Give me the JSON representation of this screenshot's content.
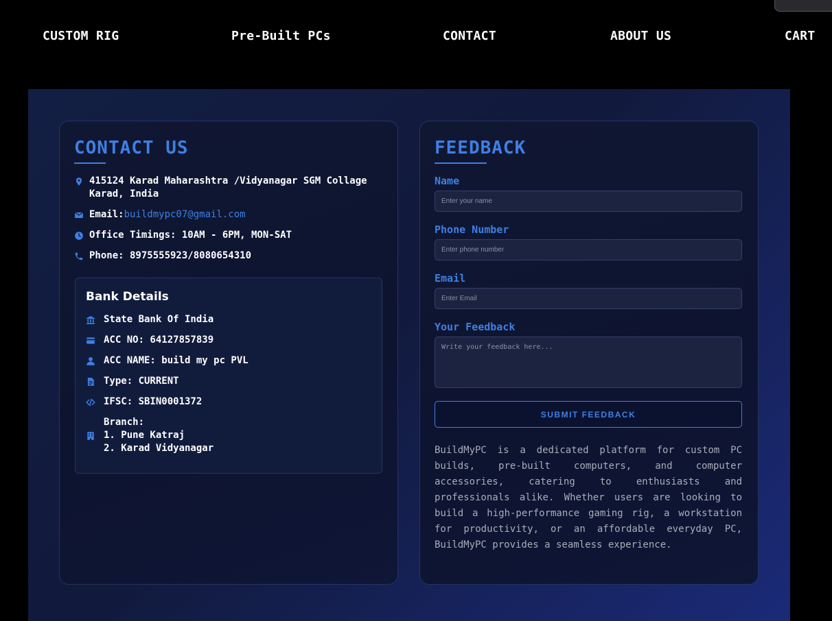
{
  "nav": {
    "items": [
      {
        "label": "CUSTOM RIG"
      },
      {
        "label": "Pre-Built PCs"
      },
      {
        "label": "CONTACT"
      },
      {
        "label": "ABOUT US"
      },
      {
        "label": "CART"
      }
    ]
  },
  "contact": {
    "title": "CONTACT US",
    "address_line1": "415124 Karad Maharashtra /Vidyanagar SGM Collage",
    "address_line2": "Karad, India",
    "email_label": "Email:",
    "email_value": "buildmypc07@gmail.com",
    "timings": "Office Timings: 10AM - 6PM, MON-SAT",
    "phone": "Phone: 8975555923/8080654310",
    "icons": [
      "location-pin-icon",
      "envelope-icon",
      "clock-icon",
      "phone-icon"
    ]
  },
  "bank": {
    "title": "Bank Details",
    "bank_name": "State Bank Of India",
    "acc_no": "ACC NO: 64127857839",
    "acc_name": "ACC NAME: build my pc PVL",
    "type": "Type: CURRENT",
    "ifsc": "IFSC: SBIN0001372",
    "branch_label": "Branch:",
    "branch_1": "1. Pune Katraj",
    "branch_2": "2. Karad Vidyanagar",
    "icons": [
      "bank-icon",
      "credit-card-icon",
      "user-icon",
      "document-icon",
      "code-icon",
      "building-icon"
    ]
  },
  "feedback": {
    "title": "FEEDBACK",
    "name_label": "Name",
    "name_placeholder": "Enter your name",
    "name_value": "",
    "phone_label": "Phone Number",
    "phone_placeholder": "Enter phone number",
    "phone_value": "",
    "email_label": "Email",
    "email_placeholder": "Enter Email",
    "email_value": "",
    "message_label": "Your Feedback",
    "message_placeholder": "Write your feedback here...",
    "message_value": "",
    "submit_label": "SUBMIT FEEDBACK"
  },
  "about": {
    "text": "BuildMyPC is a dedicated platform for custom PC builds, pre-built computers, and computer accessories, catering to enthusiasts and professionals alike. Whether users are looking to build a high-performance gaming rig, a workstation for productivity, or an affordable everyday PC, BuildMyPC provides a seamless experience."
  },
  "colors": {
    "accent": "#3f7fe3",
    "page_bg": "#000000",
    "card_bg": "#0d1430",
    "section_gradient_end": "#1b2a78"
  }
}
